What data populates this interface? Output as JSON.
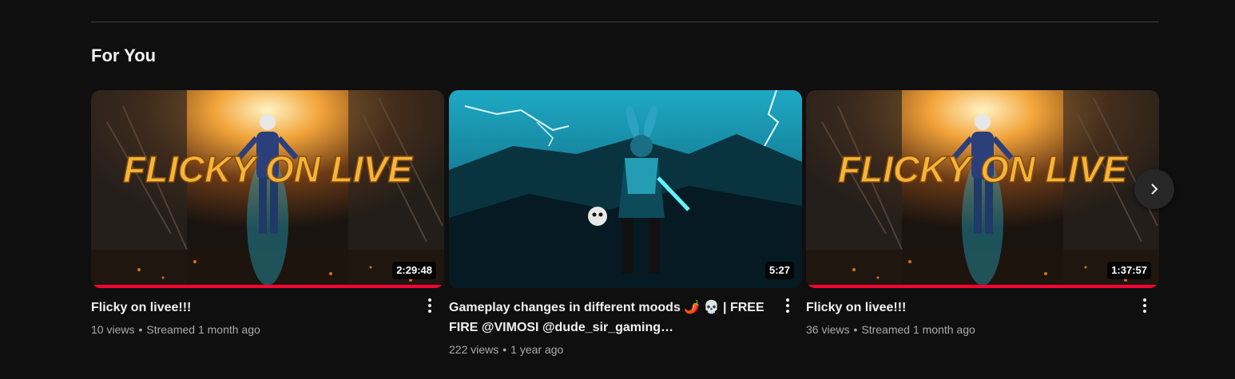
{
  "section": {
    "title": "For You"
  },
  "colors": {
    "background": "#0f0f0f",
    "progress": "#ff0033",
    "secondary_text": "#aaaaaa"
  },
  "videos": [
    {
      "title": "Flicky on livee!!!",
      "views": "10 views",
      "age": "Streamed 1 month ago",
      "duration": "2:29:48",
      "thumbnail_text": "FLICKY ON LIVE",
      "watched_fraction": 1.0,
      "thumbnail": "flicky-live-art"
    },
    {
      "title": "Gameplay changes in different moods 🌶️ 💀 | FREE FIRE @VIMOSI @dude_sir_gaming…",
      "views": "222 views",
      "age": "1 year ago",
      "duration": "5:27",
      "watched_fraction": 0.0,
      "thumbnail": "rabbit-warrior-lightning"
    },
    {
      "title": "Flicky on livee!!!",
      "views": "36 views",
      "age": "Streamed 1 month ago",
      "duration": "1:37:57",
      "thumbnail_text": "FLICKY ON LIVE",
      "watched_fraction": 1.0,
      "thumbnail": "flicky-live-art"
    }
  ],
  "icons": {
    "menu": "more-vert-icon",
    "next": "chevron-right-icon"
  }
}
